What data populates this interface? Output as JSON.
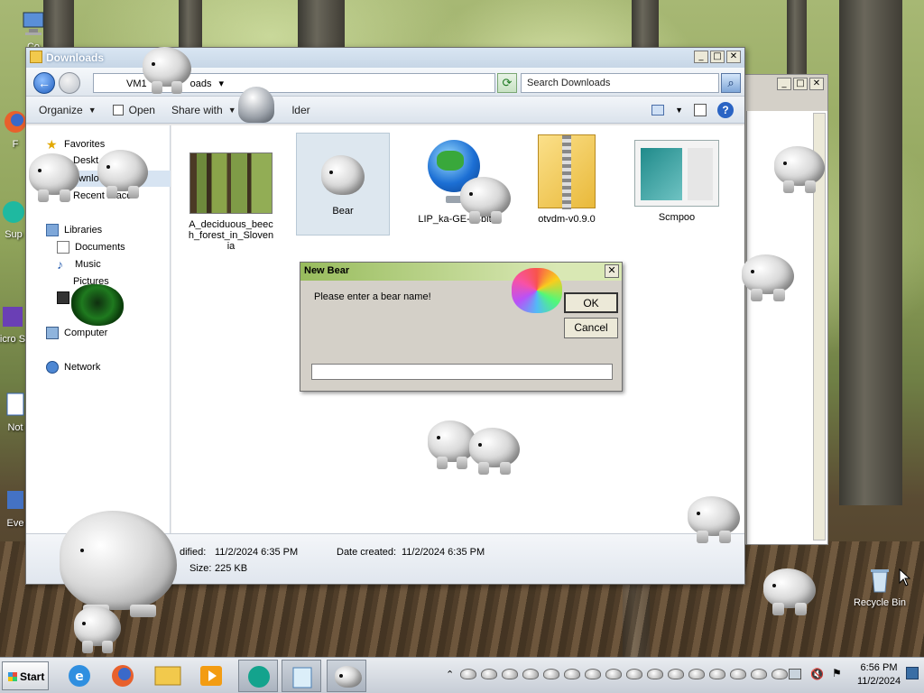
{
  "desktop": {
    "icons": [
      {
        "label": "Co",
        "icon": "computer-icon"
      },
      {
        "label": "F",
        "icon": "firefox-shortcut-icon"
      },
      {
        "label": "Sup",
        "icon": "app-shortcut-icon"
      },
      {
        "label": "Micro Stu",
        "icon": "app-shortcut-icon"
      },
      {
        "label": "Not",
        "icon": "notepad-shortcut-icon"
      },
      {
        "label": "Eve",
        "icon": "app-shortcut-icon"
      },
      {
        "label": "Recycle Bin",
        "icon": "recycle-bin-icon"
      }
    ]
  },
  "explorer": {
    "title": "Downloads",
    "address": {
      "parts": [
        "VM1",
        "oads"
      ]
    },
    "search_placeholder": "Search Downloads",
    "toolbar": {
      "organize": "Organize",
      "open": "Open",
      "share_with": "Share with",
      "new_folder_partial": "lder"
    },
    "nav": {
      "favorites": "Favorites",
      "desktop_partial": "Deskt",
      "downloads_partial": "ownlo",
      "recent_places": "Recent Places",
      "libraries": "Libraries",
      "documents": "Documents",
      "music": "Music",
      "pictures_partial": "Pictures",
      "computer": "Computer",
      "network": "Network"
    },
    "files": [
      {
        "name": "A_deciduous_beech_forest_in_Slovenia",
        "icon": "forest-image-thumbnail",
        "selected": false
      },
      {
        "name": "Bear",
        "icon": "bear-app-icon",
        "selected": true
      },
      {
        "name": "LIP_ka-GE-64bit",
        "icon": "globe-installer-icon",
        "selected": false
      },
      {
        "name": "otvdm-v0.9.0",
        "icon": "zip-folder-icon",
        "selected": false
      },
      {
        "name": "Scmpoo",
        "icon": "app-window-icon",
        "selected": false
      }
    ],
    "details": {
      "modified_partial": "dified:",
      "modified_value": "11/2/2024 6:35 PM",
      "created_label": "Date created:",
      "created_value": "11/2/2024 6:35 PM",
      "size_label": "Size:",
      "size_value": "225 KB"
    }
  },
  "dialog": {
    "title": "New Bear",
    "message": "Please enter a bear name!",
    "ok": "OK",
    "cancel": "Cancel",
    "input_value": ""
  },
  "taskbar": {
    "start": "Start",
    "pinned": [
      "ie-icon",
      "firefox-icon",
      "explorer-icon",
      "media-player-icon",
      "app-round-icon",
      "notepad-icon",
      "bear-icon"
    ],
    "tray_bear_count": 16,
    "time": "6:56 PM",
    "date": "11/2/2024"
  }
}
